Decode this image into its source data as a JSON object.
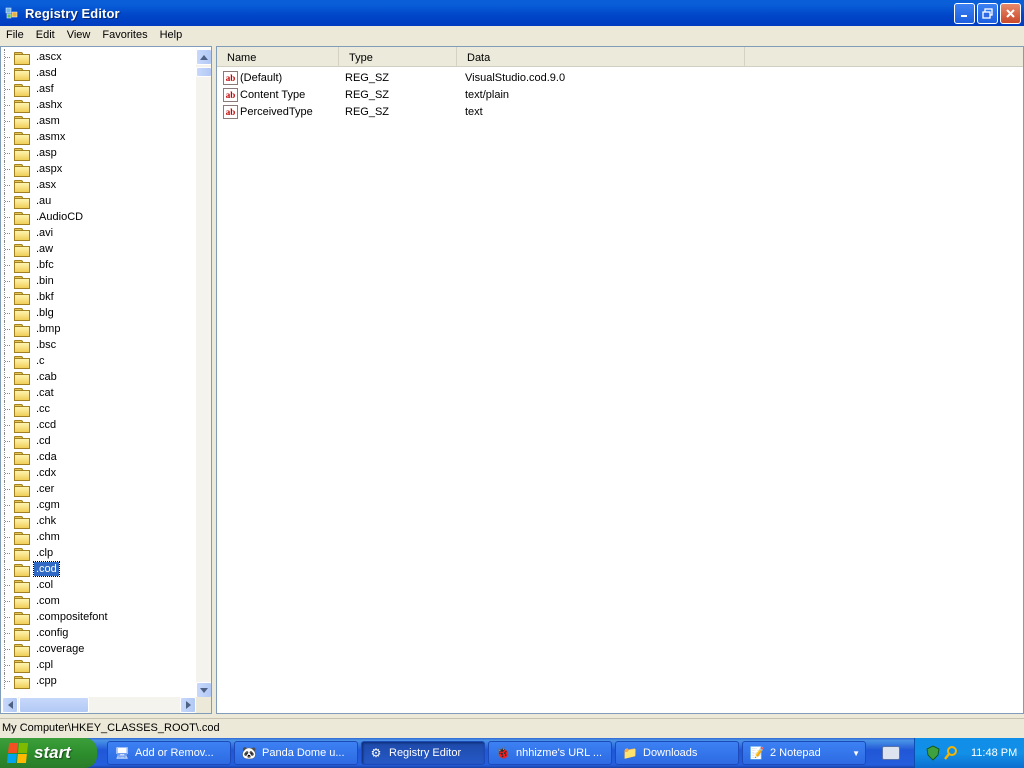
{
  "window": {
    "title": "Registry Editor"
  },
  "menu": [
    "File",
    "Edit",
    "View",
    "Favorites",
    "Help"
  ],
  "tree": {
    "items": [
      ".ascx",
      ".asd",
      ".asf",
      ".ashx",
      ".asm",
      ".asmx",
      ".asp",
      ".aspx",
      ".asx",
      ".au",
      ".AudioCD",
      ".avi",
      ".aw",
      ".bfc",
      ".bin",
      ".bkf",
      ".blg",
      ".bmp",
      ".bsc",
      ".c",
      ".cab",
      ".cat",
      ".cc",
      ".ccd",
      ".cd",
      ".cda",
      ".cdx",
      ".cer",
      ".cgm",
      ".chk",
      ".chm",
      ".clp",
      ".cod",
      ".col",
      ".com",
      ".compositefont",
      ".config",
      ".coverage",
      ".cpl",
      ".cpp"
    ],
    "selected": ".cod"
  },
  "list": {
    "columns": [
      "Name",
      "Type",
      "Data"
    ],
    "rows": [
      {
        "name": "(Default)",
        "type": "REG_SZ",
        "data": "VisualStudio.cod.9.0"
      },
      {
        "name": "Content Type",
        "type": "REG_SZ",
        "data": "text/plain"
      },
      {
        "name": "PerceivedType",
        "type": "REG_SZ",
        "data": "text"
      }
    ]
  },
  "statusbar": {
    "path": "My Computer\\HKEY_CLASSES_ROOT\\.cod"
  },
  "taskbar": {
    "start_label": "start",
    "items": [
      {
        "label": "Add or Remov...",
        "icon": "add-remove-programs-icon"
      },
      {
        "label": "Panda Dome u...",
        "icon": "panda-icon"
      },
      {
        "label": "Registry Editor",
        "icon": "regedit-icon",
        "active": true
      },
      {
        "label": "nhhizme's URL ...",
        "icon": "url-icon"
      },
      {
        "label": "Downloads",
        "icon": "folder-icon"
      },
      {
        "label": "2 Notepad",
        "icon": "notepad-icon"
      }
    ],
    "clock": "11:48 PM"
  }
}
